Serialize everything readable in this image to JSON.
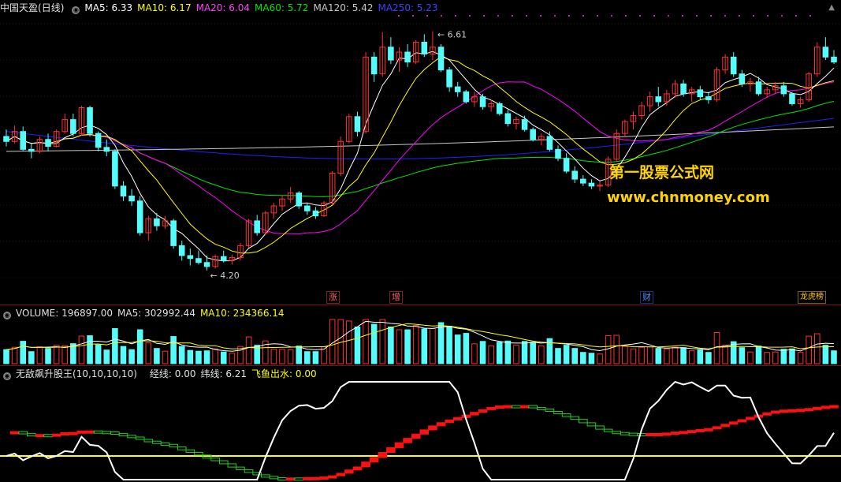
{
  "price_header": {
    "stock": "中国天盈",
    "period": "(日线)",
    "ma5": "MA5: 6.33",
    "ma10": "MA10: 6.17",
    "ma20": "MA20: 6.04",
    "ma60": "MA60: 5.72",
    "ma120": "MA120: 5.42",
    "ma250": "MA250: 5.23"
  },
  "colors": {
    "up": "#ff3030",
    "down": "#54fcfc",
    "ma5": "#ffffff",
    "ma10": "#ffff00",
    "ma20": "#ff00ff",
    "ma60": "#00e600",
    "ma120": "#c8c8c8",
    "ma250": "#2020ff"
  },
  "annotations": {
    "high": "6.61",
    "low": "4.20"
  },
  "events": [
    {
      "label": "涨",
      "color": "#ff6060"
    },
    {
      "label": "增",
      "color": "#ff6060"
    },
    {
      "label": "财",
      "color": "#4080ff"
    },
    {
      "label": "龙虎榜",
      "color": "#ffcc00"
    }
  ],
  "watermark": {
    "line1": "第一股票公式网",
    "line2": "www.chnmoney.com"
  },
  "volume_header": {
    "volume": "VOLUME: 196897.00",
    "ma5": "MA5: 302992.44",
    "ma10": "MA10: 234366.14"
  },
  "indicator_header": {
    "name": "无敌飙升股王(10,10,10,10)",
    "jingxian": "经线: 0.00",
    "weixian": "纬线: 6.21",
    "feiyu": "飞鱼出水: 0.00"
  },
  "chart_data": {
    "type": "candlestick",
    "ylim": [
      4.0,
      6.75
    ],
    "candles": [
      [
        5.55,
        5.62,
        5.45,
        5.5
      ],
      [
        5.5,
        5.66,
        5.48,
        5.6
      ],
      [
        5.6,
        5.65,
        5.4,
        5.42
      ],
      [
        5.42,
        5.48,
        5.33,
        5.4
      ],
      [
        5.4,
        5.55,
        5.38,
        5.52
      ],
      [
        5.52,
        5.58,
        5.4,
        5.45
      ],
      [
        5.45,
        5.62,
        5.44,
        5.6
      ],
      [
        5.6,
        5.78,
        5.58,
        5.72
      ],
      [
        5.72,
        5.78,
        5.55,
        5.58
      ],
      [
        5.58,
        5.86,
        5.56,
        5.84
      ],
      [
        5.84,
        5.86,
        5.55,
        5.58
      ],
      [
        5.58,
        5.6,
        5.4,
        5.44
      ],
      [
        5.44,
        5.52,
        5.35,
        5.4
      ],
      [
        5.4,
        5.42,
        5.02,
        5.05
      ],
      [
        5.05,
        5.1,
        4.9,
        4.95
      ],
      [
        4.95,
        5.02,
        4.85,
        4.9
      ],
      [
        4.9,
        4.95,
        4.55,
        4.58
      ],
      [
        4.58,
        4.75,
        4.5,
        4.72
      ],
      [
        4.72,
        4.78,
        4.6,
        4.65
      ],
      [
        4.65,
        4.75,
        4.62,
        4.7
      ],
      [
        4.7,
        4.72,
        4.42,
        4.45
      ],
      [
        4.45,
        4.5,
        4.3,
        4.35
      ],
      [
        4.35,
        4.42,
        4.25,
        4.32
      ],
      [
        4.32,
        4.4,
        4.26,
        4.28
      ],
      [
        4.28,
        4.35,
        4.2,
        4.24
      ],
      [
        4.24,
        4.36,
        4.22,
        4.34
      ],
      [
        4.34,
        4.4,
        4.28,
        4.3
      ],
      [
        4.3,
        4.36,
        4.26,
        4.33
      ],
      [
        4.33,
        4.48,
        4.3,
        4.45
      ],
      [
        4.45,
        4.72,
        4.43,
        4.7
      ],
      [
        4.7,
        4.76,
        4.55,
        4.58
      ],
      [
        4.58,
        4.8,
        4.56,
        4.78
      ],
      [
        4.78,
        4.88,
        4.72,
        4.85
      ],
      [
        4.85,
        4.96,
        4.8,
        4.92
      ],
      [
        4.92,
        5.04,
        4.88,
        4.98
      ],
      [
        4.98,
        5.0,
        4.82,
        4.85
      ],
      [
        4.85,
        4.88,
        4.76,
        4.8
      ],
      [
        4.8,
        4.84,
        4.72,
        4.75
      ],
      [
        4.75,
        4.9,
        4.74,
        4.88
      ],
      [
        4.88,
        5.2,
        4.86,
        5.18
      ],
      [
        5.18,
        5.55,
        5.15,
        5.5
      ],
      [
        5.5,
        5.78,
        5.48,
        5.75
      ],
      [
        5.75,
        5.8,
        5.55,
        5.6
      ],
      [
        5.6,
        6.4,
        5.58,
        6.35
      ],
      [
        6.35,
        6.4,
        6.1,
        6.18
      ],
      [
        6.18,
        6.6,
        6.15,
        6.45
      ],
      [
        6.45,
        6.55,
        6.28,
        6.32
      ],
      [
        6.32,
        6.45,
        6.2,
        6.4
      ],
      [
        6.4,
        6.48,
        6.25,
        6.3
      ],
      [
        6.3,
        6.52,
        6.28,
        6.5
      ],
      [
        6.5,
        6.58,
        6.35,
        6.38
      ],
      [
        6.38,
        6.61,
        6.32,
        6.45
      ],
      [
        6.45,
        6.48,
        6.2,
        6.22
      ],
      [
        6.22,
        6.25,
        6.0,
        6.05
      ],
      [
        6.05,
        6.1,
        5.95,
        6.0
      ],
      [
        6.0,
        6.02,
        5.88,
        5.9
      ],
      [
        5.9,
        6.0,
        5.85,
        5.95
      ],
      [
        5.95,
        5.98,
        5.82,
        5.85
      ],
      [
        5.85,
        5.92,
        5.8,
        5.88
      ],
      [
        5.88,
        5.9,
        5.76,
        5.78
      ],
      [
        5.78,
        5.82,
        5.65,
        5.68
      ],
      [
        5.68,
        5.75,
        5.62,
        5.72
      ],
      [
        5.72,
        5.76,
        5.6,
        5.62
      ],
      [
        5.62,
        5.64,
        5.5,
        5.52
      ],
      [
        5.52,
        5.58,
        5.46,
        5.55
      ],
      [
        5.55,
        5.6,
        5.4,
        5.42
      ],
      [
        5.42,
        5.46,
        5.3,
        5.33
      ],
      [
        5.33,
        5.38,
        5.18,
        5.2
      ],
      [
        5.2,
        5.25,
        5.08,
        5.12
      ],
      [
        5.12,
        5.16,
        5.05,
        5.08
      ],
      [
        5.08,
        5.12,
        5.02,
        5.05
      ],
      [
        5.05,
        5.1,
        5.0,
        5.06
      ],
      [
        5.06,
        5.35,
        5.04,
        5.32
      ],
      [
        5.32,
        5.62,
        5.3,
        5.58
      ],
      [
        5.58,
        5.72,
        5.54,
        5.7
      ],
      [
        5.7,
        5.8,
        5.62,
        5.76
      ],
      [
        5.76,
        5.9,
        5.72,
        5.86
      ],
      [
        5.86,
        6.0,
        5.8,
        5.95
      ],
      [
        5.95,
        6.05,
        5.85,
        5.9
      ],
      [
        5.9,
        6.02,
        5.86,
        5.98
      ],
      [
        5.98,
        6.12,
        5.94,
        6.08
      ],
      [
        6.08,
        6.12,
        5.95,
        5.98
      ],
      [
        5.98,
        6.05,
        5.9,
        6.02
      ],
      [
        6.02,
        6.06,
        5.92,
        5.95
      ],
      [
        5.95,
        6.0,
        5.88,
        5.92
      ],
      [
        5.92,
        6.25,
        5.9,
        6.22
      ],
      [
        6.22,
        6.38,
        6.18,
        6.35
      ],
      [
        6.35,
        6.4,
        6.15,
        6.18
      ],
      [
        6.18,
        6.22,
        6.05,
        6.08
      ],
      [
        6.08,
        6.14,
        6.0,
        6.1
      ],
      [
        6.1,
        6.15,
        5.96,
        5.98
      ],
      [
        5.98,
        6.05,
        5.94,
        6.02
      ],
      [
        6.02,
        6.1,
        5.98,
        6.06
      ],
      [
        6.06,
        6.1,
        5.95,
        5.98
      ],
      [
        5.98,
        6.0,
        5.86,
        5.88
      ],
      [
        5.88,
        5.95,
        5.84,
        5.92
      ],
      [
        5.92,
        6.2,
        5.9,
        6.18
      ],
      [
        6.18,
        6.5,
        6.15,
        6.45
      ],
      [
        6.45,
        6.55,
        6.32,
        6.35
      ],
      [
        6.35,
        6.42,
        6.28,
        6.3
      ]
    ]
  }
}
